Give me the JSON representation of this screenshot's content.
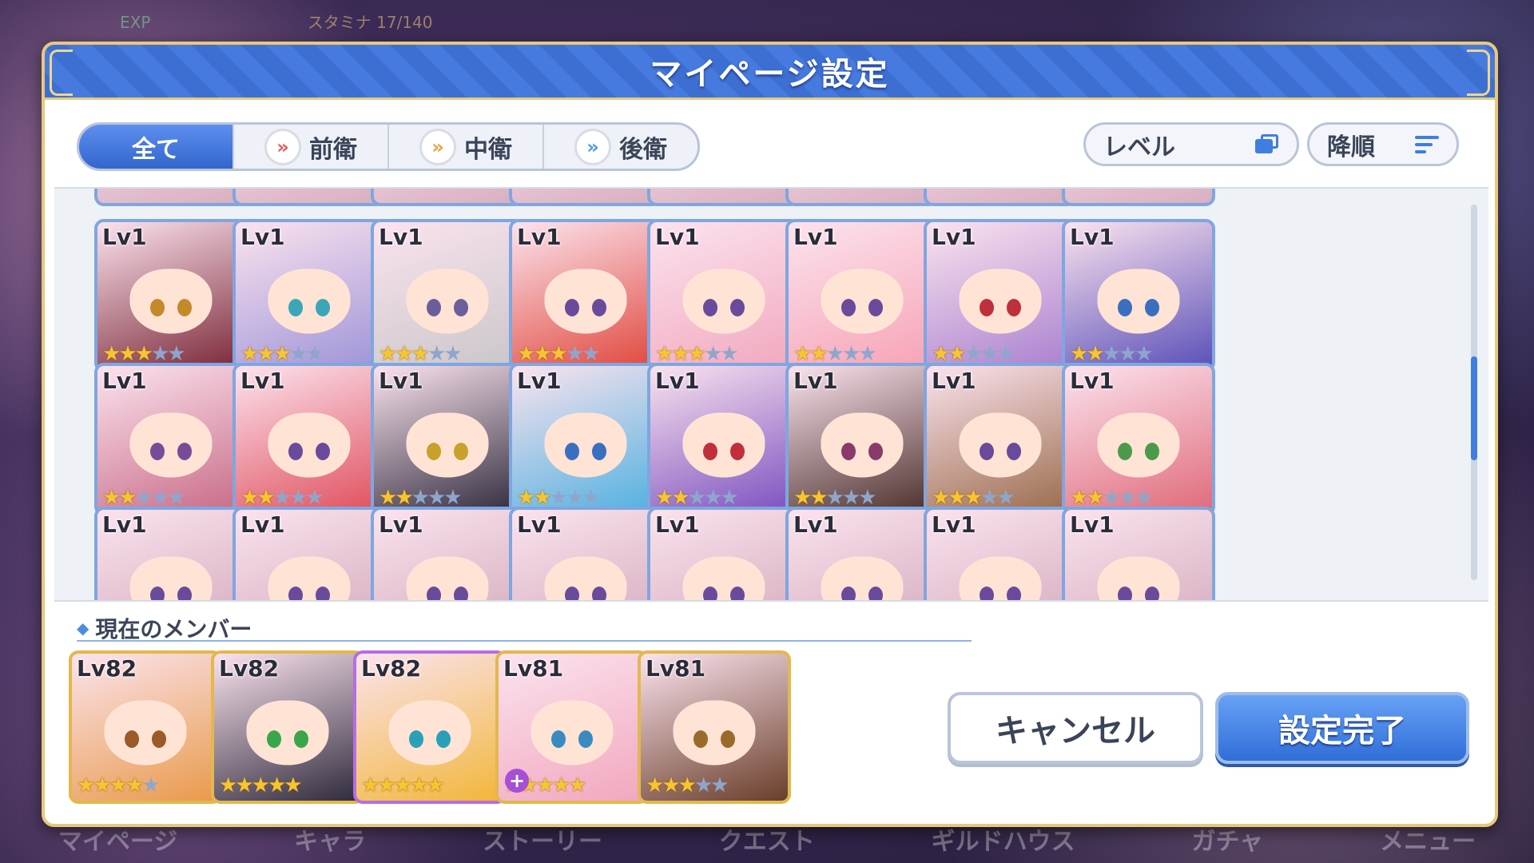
{
  "background": {
    "hud_exp": "EXP",
    "hud_stamina": "スタミナ 17/140",
    "nav_items": [
      "マイページ",
      "キャラ",
      "ストーリー",
      "クエスト",
      "ギルドハウス",
      "ガチャ",
      "メニュー"
    ]
  },
  "dialog": {
    "title": "マイページ設定"
  },
  "tabs": [
    {
      "label": "全て",
      "active": true
    },
    {
      "label": "前衛",
      "active": false,
      "icon": "front-role-icon"
    },
    {
      "label": "中衛",
      "active": false,
      "icon": "middle-role-icon"
    },
    {
      "label": "後衛",
      "active": false,
      "icon": "back-role-icon"
    }
  ],
  "sort": {
    "level_label": "レベル",
    "order_label": "降順"
  },
  "grid": {
    "rows": [
      [
        {
          "lv": "Lv1",
          "stars": 3,
          "hair": "#7a2636",
          "eye": "#c48a2a"
        },
        {
          "lv": "Lv1",
          "stars": 3,
          "hair": "#9d93d8",
          "eye": "#3aa6b8"
        },
        {
          "lv": "Lv1",
          "stars": 3,
          "hair": "#c9c6c9",
          "eye": "#6a5f9a"
        },
        {
          "lv": "Lv1",
          "stars": 3,
          "hair": "#e0463a",
          "eye": "#6a4a9a"
        },
        {
          "lv": "Lv1",
          "stars": 3,
          "hair": "#f2a7be",
          "eye": "#6a4a9a"
        },
        {
          "lv": "Lv1",
          "stars": 2,
          "hair": "#f7a2b5",
          "eye": "#6a4a9a"
        },
        {
          "lv": "Lv1",
          "stars": 2,
          "hair": "#a87fcf",
          "eye": "#c0303a"
        },
        {
          "lv": "Lv1",
          "stars": 2,
          "hair": "#5a4fb8",
          "eye": "#3a6fc0"
        }
      ],
      [
        {
          "lv": "Lv1",
          "stars": 2,
          "hair": "#c86a86",
          "eye": "#7a4a9a"
        },
        {
          "lv": "Lv1",
          "stars": 2,
          "hair": "#e04e5c",
          "eye": "#6a4a9a"
        },
        {
          "lv": "Lv1",
          "stars": 2,
          "hair": "#2f2a3c",
          "eye": "#c9a02a"
        },
        {
          "lv": "Lv1",
          "stars": 2,
          "hair": "#4fb0e0",
          "eye": "#3a6fc0"
        },
        {
          "lv": "Lv1",
          "stars": 2,
          "hair": "#7a4fc0",
          "eye": "#c0303a"
        },
        {
          "lv": "Lv1",
          "stars": 2,
          "hair": "#4a2e2a",
          "eye": "#8a3a6a"
        },
        {
          "lv": "Lv1",
          "stars": 3,
          "hair": "#9a6a4a",
          "eye": "#6a4a9a"
        },
        {
          "lv": "Lv1",
          "stars": 2,
          "hair": "#e06a7a",
          "eye": "#4a9a4a"
        }
      ]
    ],
    "bottom_row_lv": [
      "Lv1",
      "Lv1",
      "Lv1",
      "Lv1",
      "Lv1",
      "Lv1",
      "Lv1",
      "Lv1"
    ]
  },
  "members": {
    "label": "現在のメンバー",
    "cards": [
      {
        "lv": "Lv82",
        "stars": 4,
        "hair": "#e99a4a",
        "eye": "#9a5a2a",
        "frame": "gold"
      },
      {
        "lv": "Lv82",
        "stars": 5,
        "hair": "#2f2a3c",
        "eye": "#3aa64a",
        "frame": "gold"
      },
      {
        "lv": "Lv82",
        "stars": 5,
        "hair": "#f2b63a",
        "eye": "#2aa0b8",
        "frame": "purple"
      },
      {
        "lv": "Lv81",
        "stars": 5,
        "hair": "#f2a7be",
        "eye": "#3a8ac0",
        "frame": "gold",
        "plus": true
      },
      {
        "lv": "Lv81",
        "stars": 3,
        "hair": "#6a3e2a",
        "eye": "#9a6a2a",
        "frame": "gold"
      }
    ]
  },
  "buttons": {
    "cancel": "キャンセル",
    "confirm": "設定完了"
  }
}
